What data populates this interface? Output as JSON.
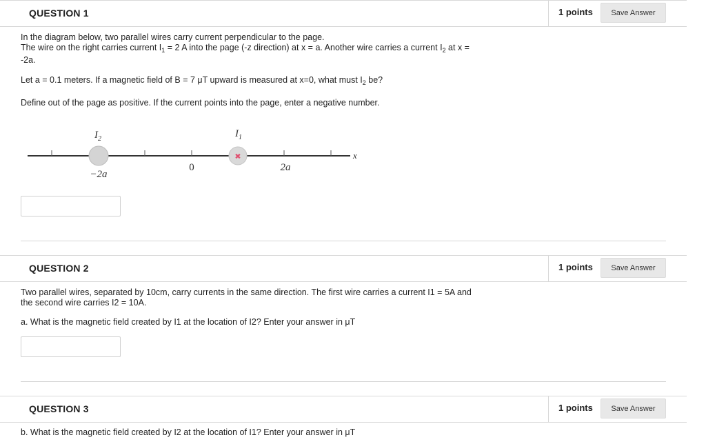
{
  "questions": [
    {
      "title": "QUESTION 1",
      "points": "1 points",
      "save_label": "Save Answer",
      "lines": {
        "l1": "In the diagram below, two parallel wires carry current perpendicular to the page.",
        "l2a": "The wire on the right carries current I",
        "l2b": "1",
        "l2c": " = 2 A into the page (-z direction) at x = a.  Another wire carries a current I",
        "l2d": "2",
        "l2e": " at x =",
        "l3": "-2a.",
        "l4a": "Let a = 0.1 meters.  If a magnetic field of B = 7 μT upward is measured at x=0, what must I",
        "l4b": "2",
        "l4c": " be?",
        "l5": "Define out of the page as positive.  If the current points into the page, enter a negative number."
      },
      "answer_value": "",
      "diagram": {
        "label_i2": "I",
        "label_i2_sub": "2",
        "label_i1": "I",
        "label_i1_sub": "1",
        "label_neg2a": "−2a",
        "label_zero": "0",
        "label_2a": "2a",
        "label_x": "x",
        "into_page_symbol": "✖"
      }
    },
    {
      "title": "QUESTION 2",
      "points": "1 points",
      "save_label": "Save Answer",
      "lines": {
        "l1": "Two parallel wires, separated by 10cm, carry currents in the same direction.  The first wire carries a current I1 = 5A and",
        "l2": "the second wire carries I2 = 10A.",
        "l3": "a. What is the magnetic field created by I1 at the location of I2?  Enter your answer in μT"
      },
      "answer_value": ""
    },
    {
      "title": "QUESTION 3",
      "points": "1 points",
      "save_label": "Save Answer",
      "lines": {
        "l1": "b. What is the magnetic field created by I2 at the location of I1?  Enter your answer in μT"
      }
    }
  ]
}
